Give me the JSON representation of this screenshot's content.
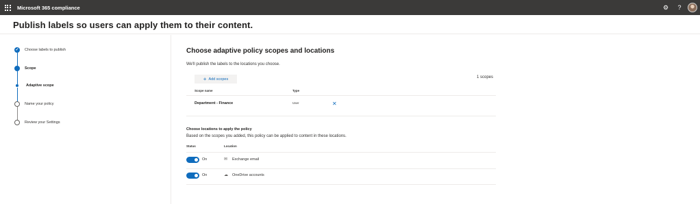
{
  "app": {
    "title": "Microsoft 365 compliance",
    "icons": [
      "waffle-icon",
      "gear-icon",
      "help-icon",
      "avatar"
    ]
  },
  "page": {
    "title": "Publish labels so users can apply them to their content."
  },
  "steps": [
    {
      "label": "Choose labels to publish",
      "state": "done"
    },
    {
      "label": "Scope",
      "state": "current"
    },
    {
      "label": "Adaptive scope",
      "state": "current-sub"
    },
    {
      "label": "Name your policy",
      "state": "pending"
    },
    {
      "label": "Review your Settings",
      "state": "pending"
    }
  ],
  "main": {
    "title": "Choose adaptive policy scopes and locations",
    "description": "We'll publish the labels to the locations you choose.",
    "add_scopes_label": "Add scopes",
    "scopes_count": "1 scopes",
    "scope_table": {
      "headers": [
        "Scope name",
        "Type"
      ],
      "rows": [
        {
          "name": "Department - Finance",
          "type": "User"
        }
      ]
    },
    "locations_title": "Choose locations to apply the policy",
    "locations_description": "Based on the scopes you added, this policy can be applied to content in these locations.",
    "locations_headers": [
      "Status",
      "Location"
    ],
    "locations": [
      {
        "status": "On",
        "name": "Exchange email",
        "icon": "exchange-icon",
        "enabled": true
      },
      {
        "status": "On",
        "name": "OneDrive accounts",
        "icon": "onedrive-icon",
        "enabled": true
      }
    ]
  },
  "colors": {
    "accent": "#0f6cbd",
    "topbar": "#3b3a39"
  }
}
